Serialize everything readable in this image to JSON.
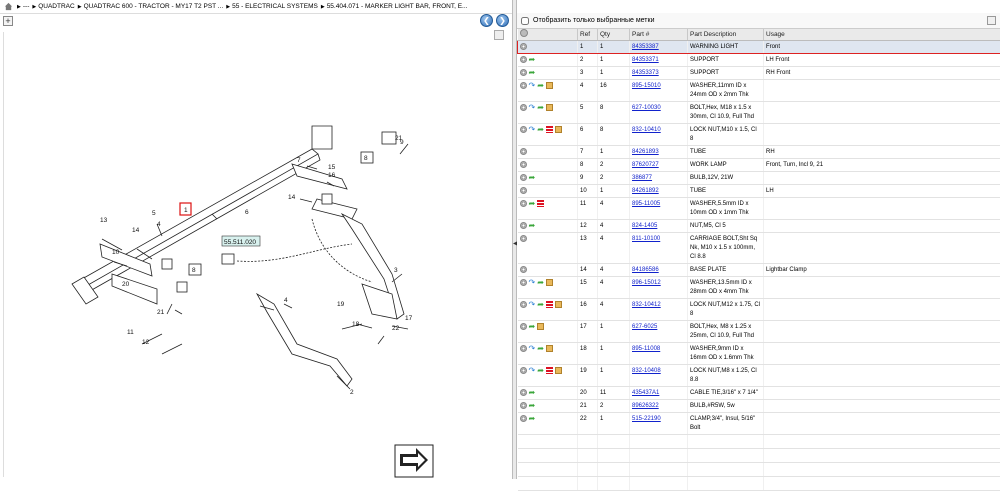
{
  "breadcrumb": [
    "---",
    "QUADTRAC",
    "QUADTRAC 600 - TRACTOR - MY17 T2 PST ...",
    "55 - ELECTRICAL SYSTEMS",
    "55.404.071 - MARKER LIGHT BAR, FRONT, E..."
  ],
  "filter_label": "Отобразить только выбранные метки",
  "columns": [
    "Ref",
    "Qty",
    "Part #",
    "Part Description",
    "Usage"
  ],
  "rows": [
    {
      "ref": "1",
      "qty": "1",
      "part": "84353387",
      "desc": "WARNING LIGHT",
      "usage": "Front",
      "icons": [],
      "tall": false,
      "selected": true
    },
    {
      "ref": "2",
      "qty": "1",
      "part": "84353371",
      "desc": "SUPPORT",
      "usage": "LH Front",
      "icons": [
        "green"
      ],
      "tall": false
    },
    {
      "ref": "3",
      "qty": "1",
      "part": "84353373",
      "desc": "SUPPORT",
      "usage": "RH Front",
      "icons": [
        "green"
      ],
      "tall": false
    },
    {
      "ref": "4",
      "qty": "16",
      "part": "895-15010",
      "desc": "WASHER,11mm ID x 24mm OD x 2mm Thk",
      "usage": "",
      "icons": [
        "blue",
        "green",
        "box"
      ],
      "tall": true
    },
    {
      "ref": "5",
      "qty": "8",
      "part": "627-10030",
      "desc": "BOLT,Hex, M18 x 1.5 x 30mm, Cl 10.9, Full Thd",
      "usage": "",
      "icons": [
        "blue",
        "green",
        "box"
      ],
      "tall": true
    },
    {
      "ref": "6",
      "qty": "8",
      "part": "832-10410",
      "desc": "LOCK NUT,M10 x 1.5, Cl 8",
      "usage": "",
      "icons": [
        "blue",
        "green",
        "red",
        "box"
      ],
      "tall": false
    },
    {
      "ref": "7",
      "qty": "1",
      "part": "84261893",
      "desc": "TUBE",
      "usage": "RH",
      "icons": [],
      "tall": false
    },
    {
      "ref": "8",
      "qty": "2",
      "part": "87620727",
      "desc": "WORK LAMP",
      "usage": "Front, Turn, Incl 9, 21",
      "icons": [],
      "tall": false
    },
    {
      "ref": "9",
      "qty": "2",
      "part": "386877",
      "desc": "BULB,12V, 21W",
      "usage": "",
      "icons": [
        "green"
      ],
      "tall": false
    },
    {
      "ref": "10",
      "qty": "1",
      "part": "84261892",
      "desc": "TUBE",
      "usage": "LH",
      "icons": [],
      "tall": false
    },
    {
      "ref": "11",
      "qty": "4",
      "part": "895-11005",
      "desc": "WASHER,5.5mm ID x 10mm OD x 1mm Thk",
      "usage": "",
      "icons": [
        "green",
        "red"
      ],
      "tall": true
    },
    {
      "ref": "12",
      "qty": "4",
      "part": "824-1405",
      "desc": "NUT,M5, Cl 5",
      "usage": "",
      "icons": [
        "green"
      ],
      "tall": false
    },
    {
      "ref": "13",
      "qty": "4",
      "part": "811-10100",
      "desc": "CARRIAGE BOLT,Sht Sq Nk, M10 x 1.5 x 100mm, Cl 8.8",
      "usage": "",
      "icons": [],
      "tall": true
    },
    {
      "ref": "14",
      "qty": "4",
      "part": "84186586",
      "desc": "BASE PLATE",
      "usage": "Lightbar Clamp",
      "icons": [],
      "tall": false
    },
    {
      "ref": "15",
      "qty": "4",
      "part": "896-15012",
      "desc": "WASHER,13.5mm ID x 28mm OD x 4mm Thk",
      "usage": "",
      "icons": [
        "blue",
        "green",
        "box"
      ],
      "tall": true
    },
    {
      "ref": "16",
      "qty": "4",
      "part": "832-10412",
      "desc": "LOCK NUT,M12 x 1.75, Cl 8",
      "usage": "",
      "icons": [
        "blue",
        "green",
        "red",
        "box"
      ],
      "tall": false
    },
    {
      "ref": "17",
      "qty": "1",
      "part": "627-6025",
      "desc": "BOLT,Hex, M8 x 1.25 x 25mm, Cl 10.9, Full Thd",
      "usage": "",
      "icons": [
        "green",
        "box"
      ],
      "tall": true
    },
    {
      "ref": "18",
      "qty": "1",
      "part": "895-11008",
      "desc": "WASHER,9mm ID x 16mm OD x 1.6mm Thk",
      "usage": "",
      "icons": [
        "blue",
        "green",
        "box"
      ],
      "tall": true
    },
    {
      "ref": "19",
      "qty": "1",
      "part": "832-10408",
      "desc": "LOCK NUT,M8 x 1.25, Cl 8.8",
      "usage": "",
      "icons": [
        "blue",
        "green",
        "red",
        "box"
      ],
      "tall": false
    },
    {
      "ref": "20",
      "qty": "11",
      "part": "435437A1",
      "desc": "CABLE TIE,3/16\" x 7 1/4\"",
      "usage": "",
      "icons": [
        "green"
      ],
      "tall": false
    },
    {
      "ref": "21",
      "qty": "2",
      "part": "89626322",
      "desc": "BULB,#R5W, 5w",
      "usage": "",
      "icons": [
        "green"
      ],
      "tall": false
    },
    {
      "ref": "22",
      "qty": "1",
      "part": "515-22190",
      "desc": "CLAMP,3/4\", Insul, 5/16\" Bolt",
      "usage": "",
      "icons": [
        "green"
      ],
      "tall": true
    }
  ],
  "diagram": {
    "callout_ref": "55.511.020",
    "labels": [
      "1",
      "2",
      "3",
      "4",
      "4",
      "5",
      "6",
      "7",
      "8",
      "8",
      "9",
      "10",
      "11",
      "12",
      "13",
      "14",
      "14",
      "15",
      "16",
      "17",
      "18",
      "19",
      "20",
      "21",
      "21",
      "22"
    ]
  }
}
